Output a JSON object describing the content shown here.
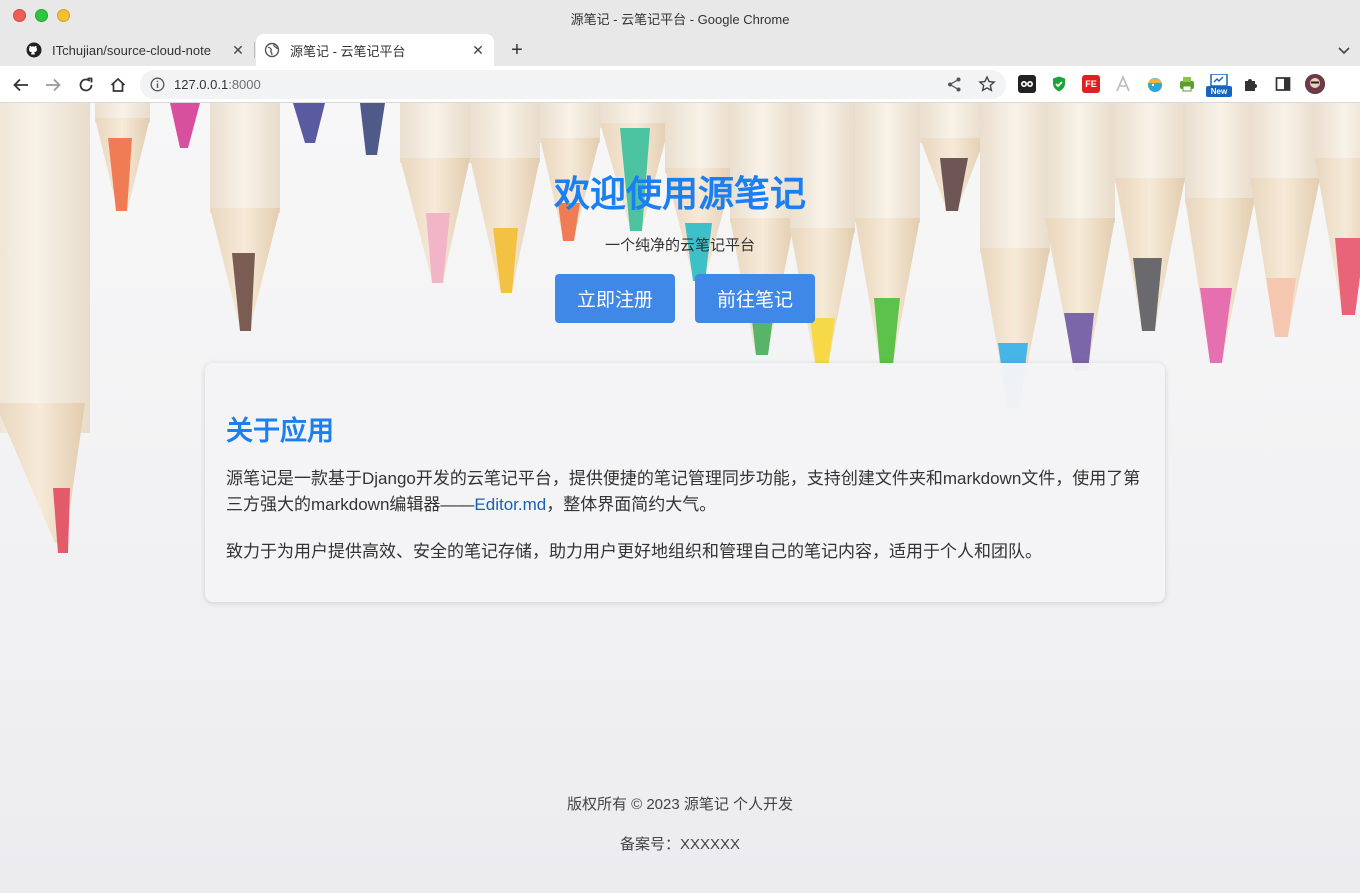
{
  "window": {
    "title": "源笔记 - 云笔记平台 - Google Chrome"
  },
  "tabs": [
    {
      "label": "ITchujian/source-cloud-note",
      "icon": "github-icon"
    },
    {
      "label": "源笔记 - 云笔记平台",
      "icon": "globe-icon"
    }
  ],
  "toolbar": {
    "url_host": "127.0.0.1",
    "url_port": ":8000",
    "extensions": [
      "shopping-ext-icon",
      "shield-ext-icon",
      "fe-ext-icon",
      "a-ext-icon",
      "bird-ext-icon",
      "printer-ext-icon",
      "new-ext-icon",
      "puzzle-icon",
      "sidebar-icon",
      "profile-avatar"
    ],
    "new_badge": "New",
    "fe_badge": "FE"
  },
  "hero": {
    "title": "欢迎使用源笔记",
    "subtitle": "一个纯净的云笔记平台",
    "register_button": "立即注册",
    "notes_button": "前往笔记"
  },
  "about": {
    "title": "关于应用",
    "p1_before": "源笔记是一款基于Django开发的云笔记平台，提供便捷的笔记管理同步功能，支持创建文件夹和markdown文件，使用了第三方强大的markdown编辑器——",
    "p1_link": "Editor.md",
    "p1_after": "，整体界面简约大气。",
    "p2": "致力于为用户提供高效、安全的笔记存储，助力用户更好地组织和管理自己的笔记内容，适用于个人和团队。"
  },
  "footer": {
    "copyright": "版权所有 © 2023 源笔记 个人开发",
    "icp": "备案号：XXXXXX"
  },
  "colors": {
    "accent": "#1a7ff0",
    "button": "#3f88e8",
    "link": "#1a5fb4"
  }
}
